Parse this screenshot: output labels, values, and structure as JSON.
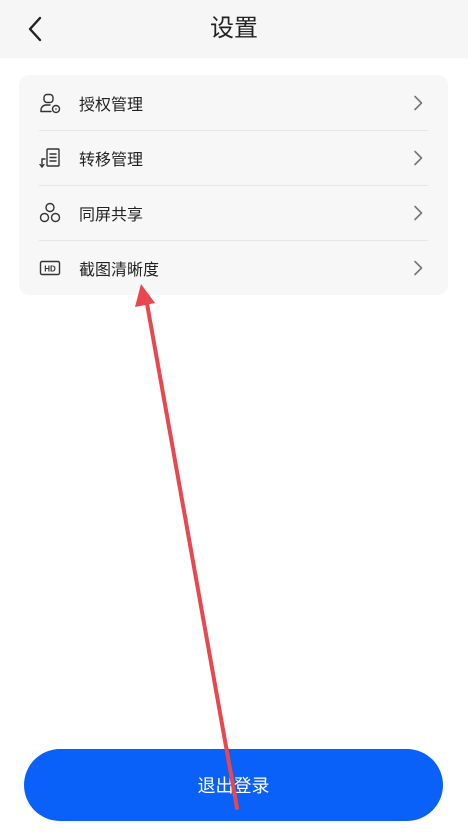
{
  "header": {
    "title": "设置",
    "back_icon": "chevron-left-icon"
  },
  "settings": {
    "items": [
      {
        "label": "授权管理",
        "icon": "user-key-icon"
      },
      {
        "label": "转移管理",
        "icon": "transfer-document-icon"
      },
      {
        "label": "同屏共享",
        "icon": "share-nodes-icon"
      },
      {
        "label": "截图清晰度",
        "icon": "hd-icon"
      }
    ]
  },
  "logout": {
    "label": "退出登录"
  },
  "colors": {
    "primary": "#0a61f9",
    "annotation_arrow": "#e8474f"
  }
}
